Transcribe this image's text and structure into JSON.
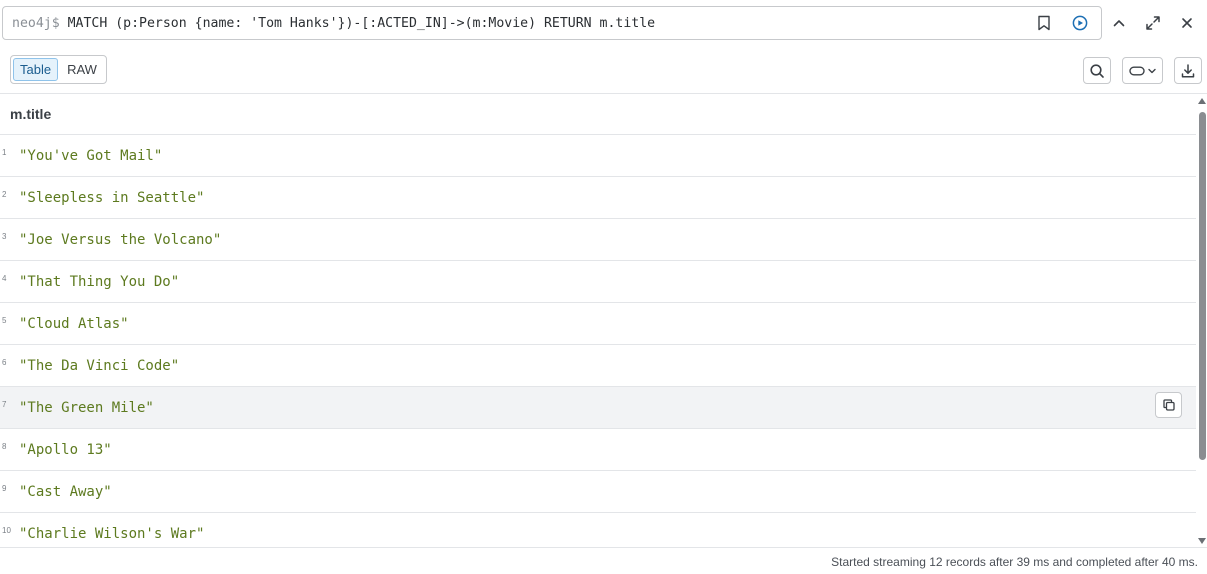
{
  "query": {
    "prompt": "neo4j$",
    "text": "MATCH (p:Person {name: 'Tom Hanks'})-[:ACTED_IN]->(m:Movie) RETURN m.title"
  },
  "view_toggle": {
    "table_label": "Table",
    "raw_label": "RAW",
    "active": "Table"
  },
  "table": {
    "column": "m.title",
    "rows": [
      {
        "num": "1",
        "value": "\"You've Got Mail\""
      },
      {
        "num": "2",
        "value": "\"Sleepless in Seattle\""
      },
      {
        "num": "3",
        "value": "\"Joe Versus the Volcano\""
      },
      {
        "num": "4",
        "value": "\"That Thing You Do\""
      },
      {
        "num": "5",
        "value": "\"Cloud Atlas\""
      },
      {
        "num": "6",
        "value": "\"The Da Vinci Code\""
      },
      {
        "num": "7",
        "value": "\"The Green Mile\""
      },
      {
        "num": "8",
        "value": "\"Apollo 13\""
      },
      {
        "num": "9",
        "value": "\"Cast Away\""
      },
      {
        "num": "10",
        "value": "\"Charlie Wilson's War\""
      }
    ]
  },
  "status": {
    "text": "Started streaming 12 records after 39 ms and completed after 40 ms."
  },
  "colors": {
    "string_value": "#5d7a1f",
    "accent": "#1b5d8f",
    "run_icon": "#1c6fb4"
  },
  "icons": [
    "bookmark-icon",
    "run-icon",
    "chevron-up-icon",
    "expand-icon",
    "close-icon",
    "search-icon",
    "toggle-icon",
    "chevron-down-icon",
    "download-icon",
    "copy-icon"
  ]
}
